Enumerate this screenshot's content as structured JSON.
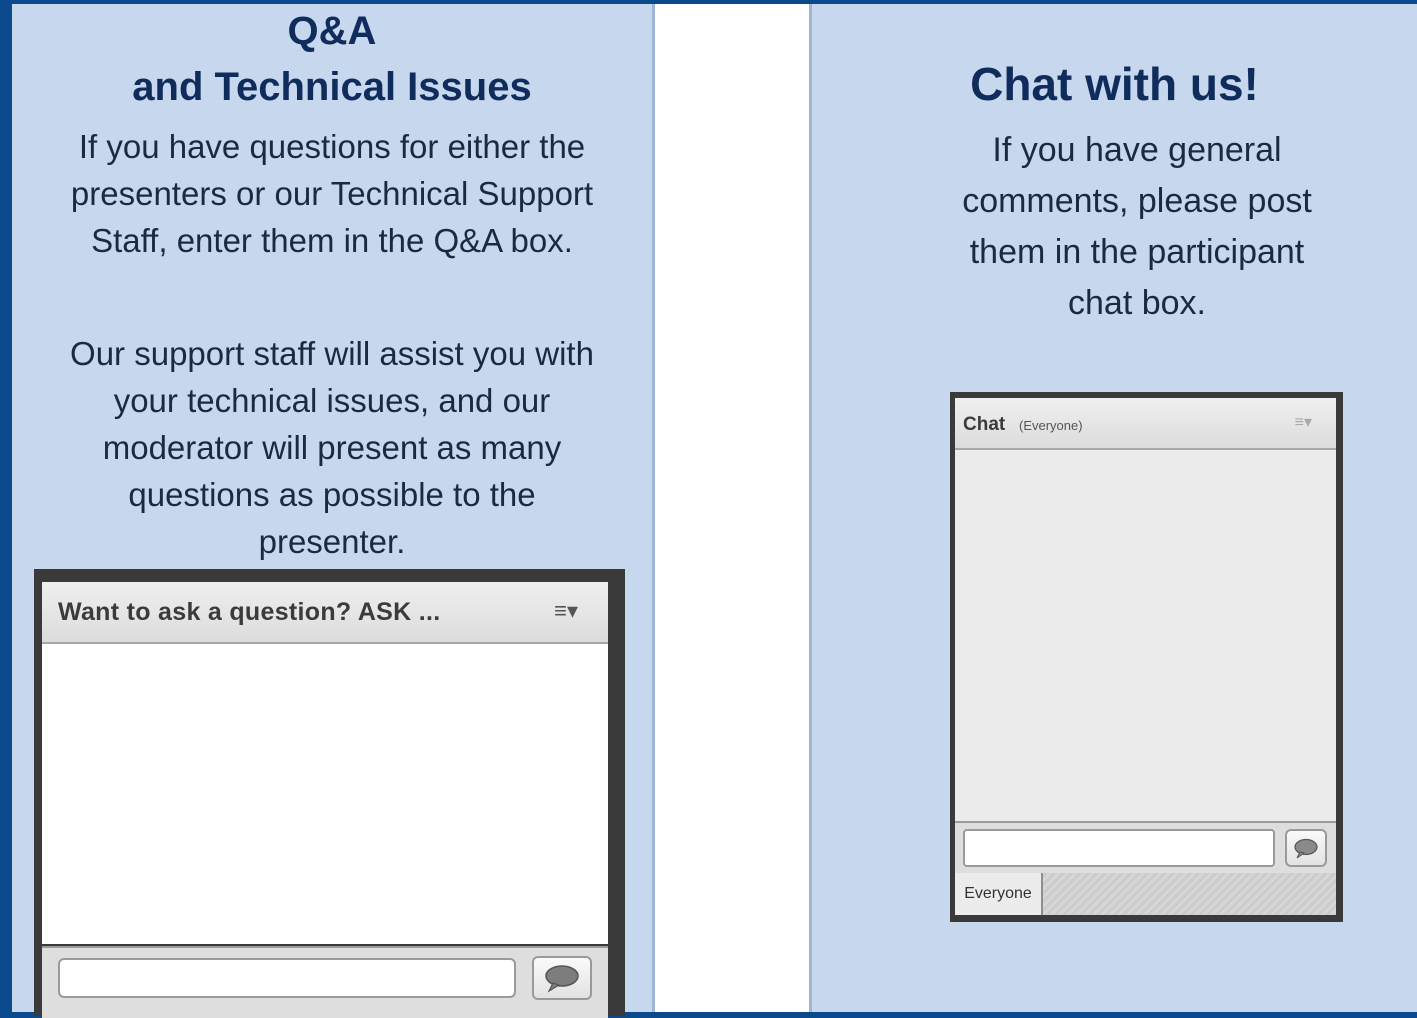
{
  "qa_panel": {
    "title_line1": "Q&A",
    "title_line2": "and Technical Issues",
    "paragraph1": [
      "If you have questions for either the",
      "presenters or our Technical Support",
      "Staff, enter them in the Q&A box."
    ],
    "paragraph2": [
      "Our support staff will assist you with",
      "your technical issues, and our",
      "moderator will present as many",
      "questions as possible to the",
      "presenter."
    ],
    "pod": {
      "header_label": "Want to ask a question? ASK ...",
      "menu_icon": "menu-list-icon",
      "send_icon": "speech-bubble-icon"
    }
  },
  "chat_panel": {
    "title": "Chat with us!",
    "paragraph": [
      "If you have general",
      "comments, please post",
      "them in the participant",
      "chat box."
    ],
    "pod": {
      "title": "Chat",
      "scope": "(Everyone)",
      "menu_icon": "menu-list-icon",
      "send_icon": "speech-bubble-icon",
      "recipient_tab": "Everyone"
    }
  },
  "colors": {
    "background": "#0b4a8c",
    "panel": "#c7d8ee",
    "title_text": "#0f2c5c",
    "pod_frame": "#3a3a3a"
  }
}
